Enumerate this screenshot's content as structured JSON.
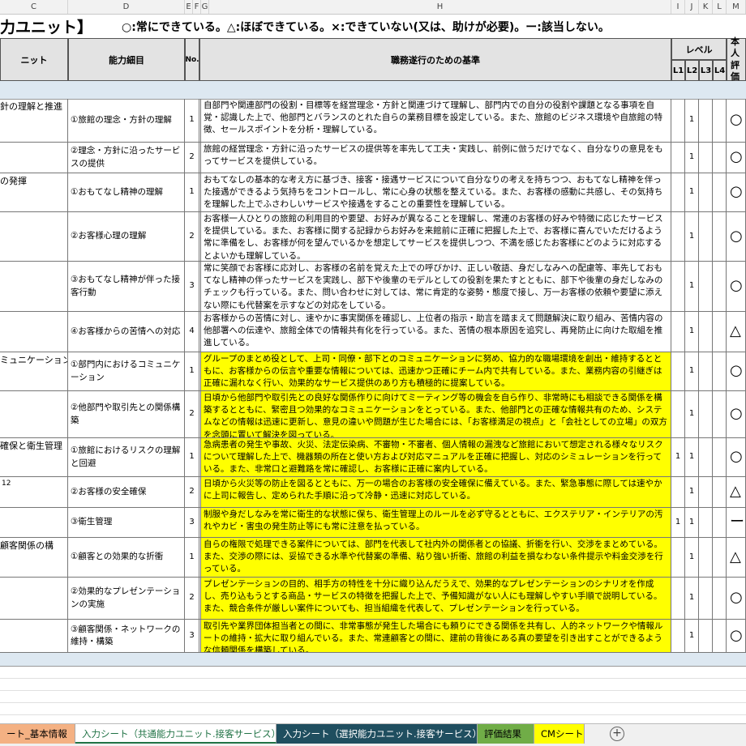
{
  "column_headers": [
    "C",
    "D",
    "E",
    "F",
    "G",
    "H",
    "I",
    "J",
    "K",
    "L",
    "M"
  ],
  "sheet_title": "力ユニット】",
  "legend_text": "○:常にできている。△:ほぼできている。×:できていない(又は、助けが必要)。ー:該当しない。",
  "table_headers": {
    "unit": "ニット",
    "detail": "能力細目",
    "no": "No.",
    "standard": "職務遂行のための基準",
    "level": "レベル",
    "l1": "L1",
    "l2": "L2",
    "l3": "L3",
    "l4": "L4",
    "eval": "本人評価"
  },
  "rows": [
    {
      "unit": "針の理解と推進",
      "detail": "①旅館の理念・方針の理解",
      "no": "1",
      "standard": "自部門や関連部門の役割・目標等を経営理念・方針と関連づけて理解し、部門内での自分の役割や課題となる事項を自覚・認識した上で、他部門とバランスのとれた自らの業務目標を設定している。また、旅館のビジネス環境や自旅館の特徴、セールスポイントを分析・理解している。",
      "l1": "",
      "l2": "1",
      "eval": "○"
    },
    {
      "unit": "",
      "detail": "②理念・方針に沿ったサービスの提供",
      "no": "2",
      "standard": "旅館の経営理念・方針に沿ったサービスの提供等を率先して工夫・実践し、前例に倣うだけでなく、自分なりの意見をもってサービスを提供している。",
      "l1": "",
      "l2": "1",
      "eval": "○"
    },
    {
      "unit": "の発揮",
      "detail": "①おもてなし精神の理解",
      "no": "1",
      "standard": "おもてなしの基本的な考え方に基づき、接客・接遇サービスについて自分なりの考えを持ちつつ、おもてなし精神を伴った接遇ができるよう気持ちをコントロールし、常に心身の状態を整えている。また、お客様の感動に共感し、その気持ちを理解した上でふさわしいサービスや接遇をすることの重要性を理解している。",
      "l1": "",
      "l2": "1",
      "eval": "○"
    },
    {
      "unit": "",
      "detail": "②お客様心理の理解",
      "no": "2",
      "standard": "お客様一人ひとりの旅館の利用目的や要望、お好みが異なることを理解し、常連のお客様の好みや特徴に応じたサービスを提供している。また、お客様に関する記録からお好みを来館前に正確に把握した上で、お客様に喜んでいただけるよう常に準備をし、お客様が何を望んでいるかを想定してサービスを提供しつつ、不満を感じたお客様にどのように対応するとよいかも理解している。",
      "l1": "",
      "l2": "1",
      "eval": "○"
    },
    {
      "unit": "",
      "detail": "③おもてなし精神が伴った接客行動",
      "no": "3",
      "standard": "常に笑顔でお客様に応対し、お客様の名前を覚えた上での呼びかけ、正しい敬語、身だしなみへの配慮等、率先しておもてなし精神の伴ったサービスを実践し、部下や後輩のモデルとしての役割を果たすとともに、部下や後輩の身だしなみのチェックも行っている。また、問い合わせに対しては、常に肯定的な姿勢・態度で接し、万一お客様の依頼や要望に添えない際にも代替案を示すなどの対応をしている。",
      "l1": "",
      "l2": "1",
      "eval": "○"
    },
    {
      "unit": "",
      "detail": "④お客様からの苦情への対応",
      "no": "4",
      "standard": "お客様からの苦情に対し、速やかに事実関係を確認し、上位者の指示・助言を踏まえて問題解決に取り組み、苦情内容の他部署への伝達や、旅館全体での情報共有化を行っている。また、苦情の根本原因を追究し、再発防止に向けた取組を推進している。",
      "l1": "",
      "l2": "1",
      "eval": "△"
    },
    {
      "unit": "ミュニケーション",
      "detail": "①部門内におけるコミュニケーション",
      "no": "1",
      "standard": "グループのまとめ役として、上司・同僚・部下とのコミュニケーションに努め、協力的な職場環境を創出・維持するとともに、お客様からの伝言や重要な情報については、迅速かつ正確にチーム内で共有している。また、業務内容の引継ぎは正確に漏れなく行い、効果的なサービス提供のあり方も積極的に提案している。",
      "l1": "",
      "l2": "1",
      "eval": "○",
      "hl": true
    },
    {
      "unit": "",
      "detail": "②他部門や取引先との関係構築",
      "no": "2",
      "standard": "日頃から他部門や取引先との良好な関係作りに向けてミーティング等の機会を自ら作り、非常時にも相談できる関係を構築するとともに、緊密且つ効果的なコミュニケーションをとっている。また、他部門との正確な情報共有のため、システムなどの情報は迅速に更新し、意見の違いや問題が生じた場合には、「お客様満足の視点」と「会社としての立場」の双方を念頭に置いて解決を図っている。",
      "l1": "",
      "l2": "1",
      "eval": "○",
      "hl": true
    },
    {
      "unit": "確保と衛生管理",
      "detail": "①旅館におけるリスクの理解と回避",
      "no": "1",
      "standard": "急病患者の発生や事故、火災、法定伝染病、不審物・不審者、個人情報の漏洩など旅館において想定される様々なリスクについて理解した上で、機器類の所在と使い方および対応マニュアルを正確に把握し、対応のシミュレーションを行っている。また、非常口と避難路を常に確認し、お客様に正確に案内している。",
      "l1": "1",
      "l2": "1",
      "eval": "○",
      "hl": true
    },
    {
      "unit": "",
      "detail": "②お客様の安全確保",
      "no": "2",
      "standard": "日頃から火災等の防止を図るとともに、万一の場合のお客様の安全確保に備えている。また、緊急事態に際しては速やかに上司に報告し、定められた手順に沿って冷静・迅速に対応している。",
      "l1": "",
      "l2": "1",
      "eval": "△",
      "hl": true
    },
    {
      "unit": "",
      "detail": "③衛生管理",
      "no": "3",
      "standard": "制服や身だしなみを常に衛生的な状態に保ち、衛生管理上のルールを必ず守るとともに、エクステリア・インテリアの汚れやカビ・害虫の発生防止等にも常に注意を払っている。",
      "l1": "1",
      "l2": "1",
      "eval": "ー",
      "hl": true
    },
    {
      "unit": "顧客関係の構",
      "detail": "①顧客との効果的な折衝",
      "no": "1",
      "standard": "自らの権限で処理できる案件については、部門を代表して社内外の関係者との協議、折衝を行い、交渉をまとめている。また、交渉の際には、妥協できる水準や代替案の準備、粘り強い折衝、旅館の利益を損なわない条件提示や料金交渉を行っている。",
      "l1": "",
      "l2": "1",
      "eval": "△",
      "hl": true
    },
    {
      "unit": "",
      "detail": "②効果的なプレゼンテーションの実施",
      "no": "2",
      "standard": "プレゼンテーションの目的、相手方の特性を十分に織り込んだうえで、効果的なプレゼンテーションのシナリオを作成し、売り込もうとする商品・サービスの特徴を把握した上で、予備知識がない人にも理解しやすい手順で説明している。また、競合条件が厳しい案件についても、担当組織を代表して、プレゼンテーションを行っている。",
      "l1": "",
      "l2": "1",
      "eval": "○",
      "hl": true
    },
    {
      "unit": "",
      "detail": "③顧客関係・ネットワークの維持・構築",
      "no": "3",
      "standard": "取引先や業界団体担当者との間に、非常事態が発生した場合にも頼りにできる関係を共有し、人的ネットワークや情報ルートの維持・拡大に取り組んでいる。また、常連顧客との間に、建前の背後にある真の要望を引き出すことができるような信頼関係を構築している。",
      "l1": "",
      "l2": "1",
      "eval": "○",
      "hl": true
    }
  ],
  "side_note": "12",
  "tabs": [
    {
      "label": "ート_基本情報",
      "color": "#f4b183"
    },
    {
      "label": "入力シート（共通能力ユニット.接客サービス）",
      "color": "#ffffff"
    },
    {
      "label": "入力シート（選択能力ユニット.接客サービス）",
      "color": "#1f4e5f"
    },
    {
      "label": "評価結果",
      "color": "#70ad47"
    },
    {
      "label": "CMシート",
      "color": "#ffff00"
    }
  ],
  "add_sheet_icon": "plus-circle-icon"
}
